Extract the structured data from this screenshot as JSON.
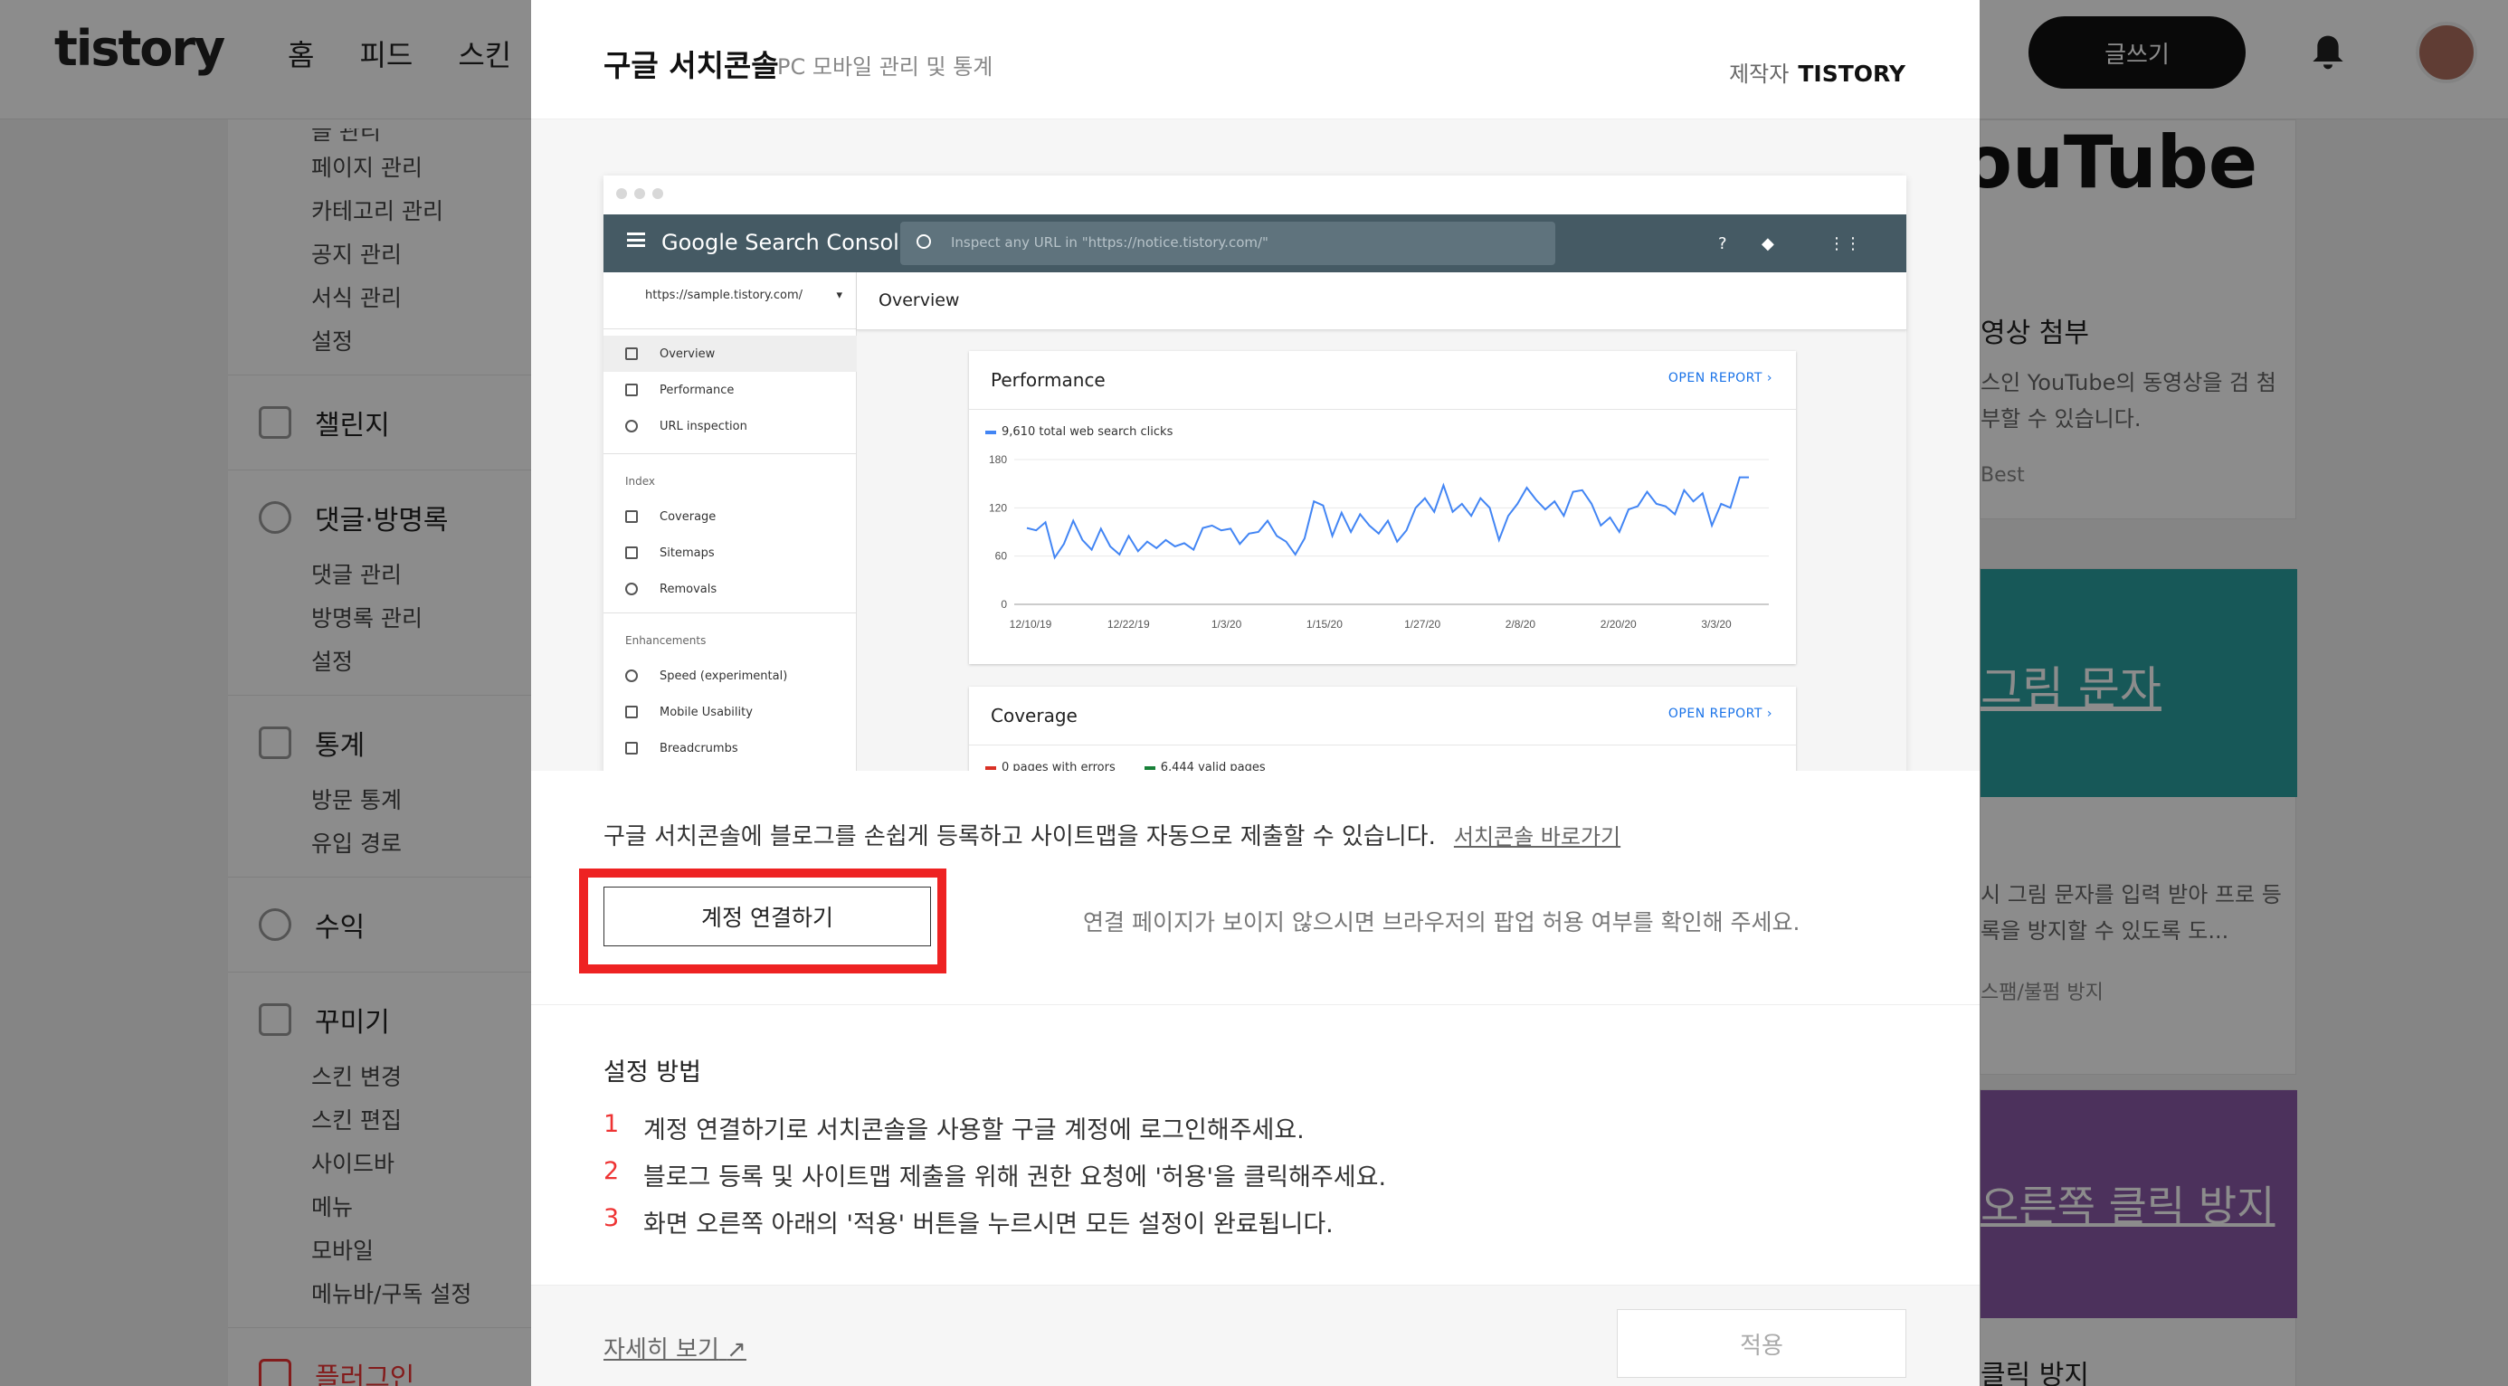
{
  "topbar": {
    "logo": "tistory",
    "nav": [
      "홈",
      "피드",
      "스킨"
    ],
    "write_label": "글쓰기"
  },
  "sidebar": {
    "manage_items": [
      "글 관리",
      "페이지 관리",
      "카테고리 관리",
      "공지 관리",
      "서식 관리",
      "설정"
    ],
    "challenge": "챌린지",
    "comments": {
      "label": "댓글·방명록",
      "items": [
        "댓글 관리",
        "방명록 관리",
        "설정"
      ]
    },
    "stats": {
      "label": "통계",
      "items": [
        "방문 통계",
        "유입 경로"
      ]
    },
    "revenue": "수익",
    "decorate": {
      "label": "꾸미기",
      "items": [
        "스킨 변경",
        "스킨 편집",
        "사이드바",
        "메뉴",
        "모바일",
        "메뉴바/구독 설정"
      ]
    },
    "plugin": "플러그인"
  },
  "right_panel": {
    "youtube_logo": "ouTube",
    "youtube_title": "영상 첨부",
    "youtube_desc": "스인 YouTube의 동영상을 검 첨부할 수 있습니다.",
    "youtube_tag": "Best",
    "captcha_banner": "그림 문자",
    "captcha_desc": "시 그림 문자를 입력 받아 프로 등록을 방지할 수 있도록 도...",
    "captcha_tag": "스팸/불펌 방지",
    "rightclick_banner": "오른쪽 클릭 방지",
    "rightclick_title": "클릭 방지"
  },
  "modal": {
    "title": "구글 서치콘솔",
    "subtitle": "PC 모바일 관리 및 통계",
    "author_label": "제작자",
    "author": "TISTORY",
    "description": "구글 서치콘솔에 블로그를 손쉽게 등록하고 사이트맵을 자동으로 제출할 수 있습니다.",
    "shortcut_link": "서치콘솔 바로가기",
    "connect_label": "계정 연결하기",
    "popup_note": "연결 페이지가 보이지 않으시면 브라우저의 팝업 허용 여부를 확인해 주세요.",
    "howto_title": "설정 방법",
    "steps": [
      {
        "n": "1",
        "text": "계정 연결하기로 서치콘솔을 사용할 구글 계정에 로그인해주세요."
      },
      {
        "n": "2",
        "text": "블로그 등록 및 사이트맵 제출을 위해 권한 요청에 '허용'을 클릭해주세요."
      },
      {
        "n": "3",
        "text": "화면 오른쪽 아래의 '적용' 버튼을 누르시면 모든 설정이 완료됩니다."
      }
    ],
    "more_link": "자세히 보기",
    "apply_label": "적용"
  },
  "gsc": {
    "logo": "Google Search Console",
    "search_placeholder": "Inspect any URL in \"https://notice.tistory.com/\"",
    "property": "https://sample.tistory.com/",
    "page_title": "Overview",
    "nav": [
      "Overview",
      "Performance",
      "URL inspection"
    ],
    "index_header": "Index",
    "index_items": [
      "Coverage",
      "Sitemaps",
      "Removals"
    ],
    "enh_header": "Enhancements",
    "enh_items": [
      "Speed (experimental)",
      "Mobile Usability",
      "Breadcrumbs"
    ],
    "performance_title": "Performance",
    "open_report": "OPEN REPORT",
    "clicks_legend": "9,610 total web search clicks",
    "coverage_title": "Coverage",
    "errors_legend": "0 pages with errors",
    "valid_legend": "6,444 valid pages"
  },
  "chart_data": {
    "type": "line",
    "title": "Performance",
    "series": [
      {
        "name": "9,610 total web search clicks",
        "values": [
          95,
          92,
          102,
          58,
          75,
          104,
          80,
          68,
          94,
          72,
          62,
          85,
          66,
          78,
          70,
          80,
          72,
          76,
          68,
          95,
          98,
          92,
          94,
          75,
          88,
          90,
          104,
          85,
          78,
          62,
          82,
          128,
          123,
          85,
          114,
          90,
          112,
          98,
          88,
          104,
          78,
          92,
          120,
          132,
          115,
          148,
          115,
          125,
          110,
          132,
          120,
          80,
          110,
          125,
          145,
          130,
          118,
          128,
          110,
          140,
          142,
          125,
          98,
          108,
          90,
          118,
          122,
          140,
          125,
          122,
          112,
          142,
          128,
          138,
          98,
          125,
          120,
          158,
          158
        ]
      }
    ],
    "x_tick_labels": [
      "12/10/19",
      "12/22/19",
      "1/3/20",
      "1/15/20",
      "1/27/20",
      "2/8/20",
      "2/20/20",
      "3/3/20"
    ],
    "y_ticks": [
      0,
      60,
      120,
      180
    ],
    "ylim": [
      0,
      180
    ],
    "color": "#4285f4"
  }
}
